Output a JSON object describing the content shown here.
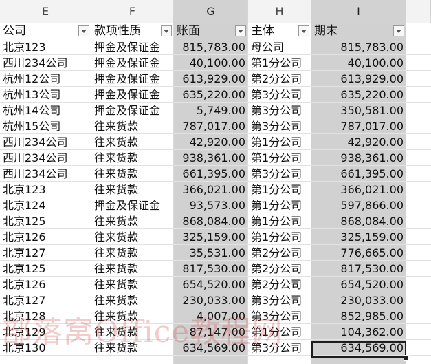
{
  "columns": [
    "E",
    "F",
    "G",
    "H",
    "I"
  ],
  "headers": [
    "公司",
    "款项性质",
    "账面",
    "主体",
    "期末"
  ],
  "rows": [
    [
      "北京123",
      "押金及保证金",
      "815,783.00",
      "母公司",
      "815,783.00"
    ],
    [
      "西川234公司",
      "押金及保证金",
      "40,100.00",
      "第1分公司",
      "40,100.00"
    ],
    [
      "杭州12公司",
      "押金及保证金",
      "613,929.00",
      "第2分公司",
      "613,929.00"
    ],
    [
      "杭州13公司",
      "押金及保证金",
      "635,220.00",
      "第3分公司",
      "635,220.00"
    ],
    [
      "杭州14公司",
      "押金及保证金",
      "5,749.00",
      "第3分公司",
      "350,581.00"
    ],
    [
      "杭州15公司",
      "往来货款",
      "787,017.00",
      "第3分公司",
      "787,017.00"
    ],
    [
      "西川234公司",
      "往来货款",
      "42,920.00",
      "第1分公司",
      "42,920.00"
    ],
    [
      "西川234公司",
      "往来货款",
      "938,361.00",
      "第1分公司",
      "938,361.00"
    ],
    [
      "西川234公司",
      "往来货款",
      "661,395.00",
      "第3分公司",
      "661,395.00"
    ],
    [
      "北京123",
      "往来货款",
      "366,021.00",
      "第1分公司",
      "366,021.00"
    ],
    [
      "北京124",
      "押金及保证金",
      "93,573.00",
      "第1分公司",
      "597,866.00"
    ],
    [
      "北京125",
      "往来货款",
      "868,084.00",
      "第1分公司",
      "868,084.00"
    ],
    [
      "北京126",
      "往来货款",
      "325,159.00",
      "第1分公司",
      "325,159.00"
    ],
    [
      "北京127",
      "往来货款",
      "35,531.00",
      "第2分公司",
      "776,665.00"
    ],
    [
      "北京125",
      "往来货款",
      "817,530.00",
      "第2分公司",
      "817,530.00"
    ],
    [
      "北京126",
      "往来货款",
      "654,520.00",
      "第2分公司",
      "654,520.00"
    ],
    [
      "北京127",
      "往来货款",
      "230,033.00",
      "第3分公司",
      "230,033.00"
    ],
    [
      "北京128",
      "往来货款",
      "4,007.00",
      "第3分公司",
      "852,985.00"
    ],
    [
      "北京129",
      "往来货款",
      "87,147.00",
      "第1分公司",
      "104,362.00"
    ],
    [
      "北京130",
      "往来货款",
      "634,569.00",
      "第3分公司",
      "634,569.00"
    ]
  ],
  "watermark": "部落窝Office教程网",
  "filter_icon": "dropdown-arrow-icon",
  "colors": {
    "selected_column": "#d1d1d1",
    "grid": "#e2e2e2",
    "header_bg": "#f3f3f3"
  }
}
